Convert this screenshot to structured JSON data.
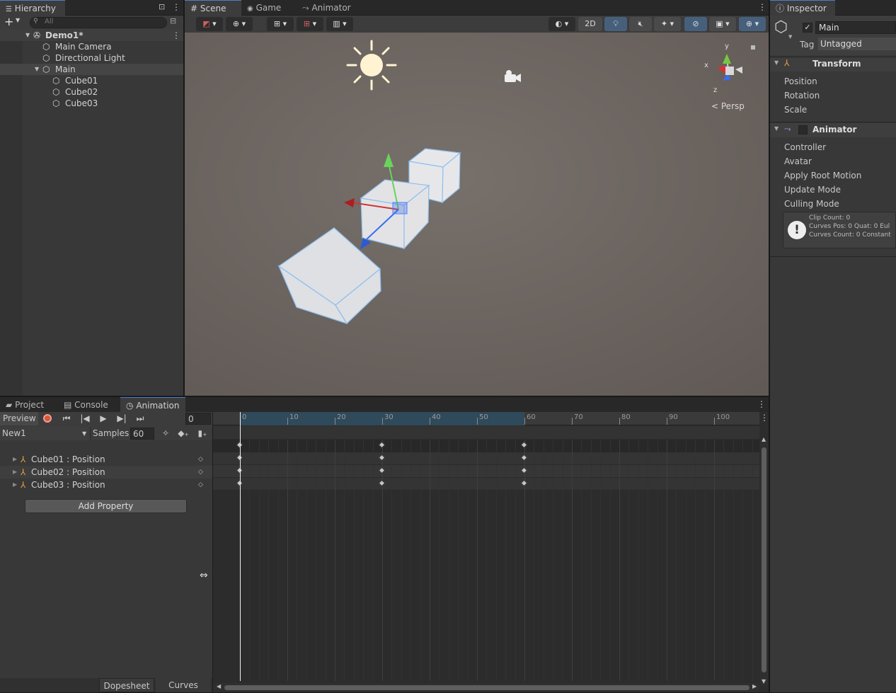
{
  "hierarchy": {
    "tab_label": "Hierarchy",
    "search_placeholder": "All",
    "scene_name": "Demo1*",
    "items": [
      "Main Camera",
      "Directional Light",
      "Main",
      "Cube01",
      "Cube02",
      "Cube03"
    ]
  },
  "scene_tabs": [
    "Scene",
    "Game",
    "Animator"
  ],
  "scene_toolbar": {
    "mode_2d": "2D"
  },
  "scene_view": {
    "persp_label": "Persp",
    "gizmo_x": "x",
    "gizmo_y": "y",
    "gizmo_z": "z"
  },
  "inspector": {
    "tab_label": "Inspector",
    "object_name": "Main",
    "tag_label": "Tag",
    "tag_value": "Untagged",
    "transform": {
      "title": "Transform",
      "fields": [
        "Position",
        "Rotation",
        "Scale"
      ]
    },
    "animator": {
      "title": "Animator",
      "fields": [
        "Controller",
        "Avatar",
        "Apply Root Motion",
        "Update Mode",
        "Culling Mode"
      ]
    },
    "info_lines": [
      "Clip Count: 0",
      "Curves Pos: 0 Quat: 0 Eul",
      "Curves Count: 0 Constant"
    ]
  },
  "bottom_tabs": [
    "Project",
    "Console",
    "Animation"
  ],
  "animation": {
    "preview_label": "Preview",
    "frame_value": "0",
    "clip_name": "New1",
    "samples_label": "Samples",
    "samples_value": "60",
    "properties": [
      "Cube01 : Position",
      "Cube02 : Position",
      "Cube03 : Position"
    ],
    "add_property_label": "Add Property",
    "view_tabs": [
      "Dopesheet",
      "Curves"
    ],
    "timeline_ticks": [
      "0",
      "10",
      "20",
      "30",
      "40",
      "50",
      "60",
      "70",
      "80",
      "90",
      "100"
    ],
    "keyframes": [
      0,
      30,
      60
    ]
  },
  "colors": {
    "accent": "#4c7ecd",
    "record": "#d8563e",
    "timeline_band": "#2f4a5a"
  }
}
